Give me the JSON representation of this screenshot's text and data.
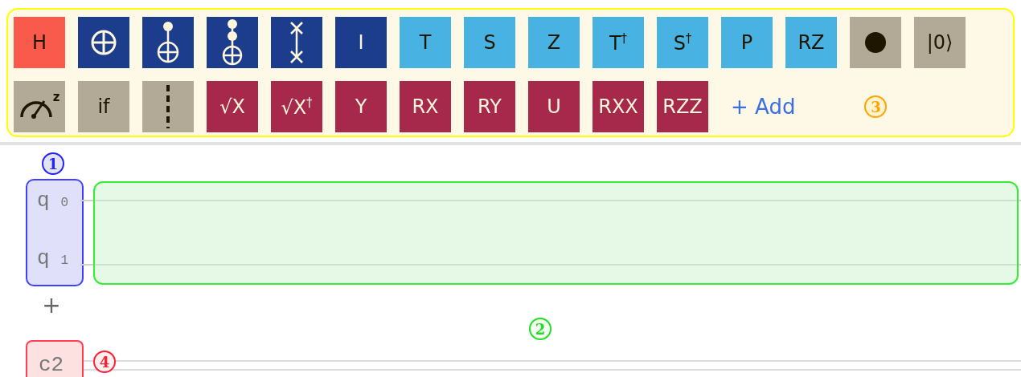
{
  "gate_palette": {
    "rows": [
      {
        "gates": [
          {
            "kind": "text",
            "label": "H",
            "color": "#fa5a4b"
          },
          {
            "kind": "not",
            "color": "#1b3d8b"
          },
          {
            "kind": "cnot",
            "color": "#1b3d8b"
          },
          {
            "kind": "toffoli",
            "color": "#1b3d8b"
          },
          {
            "kind": "swap",
            "color": "#1b3d8b"
          },
          {
            "kind": "text",
            "label": "I",
            "color": "#1b3d8b"
          },
          {
            "kind": "text",
            "label": "T",
            "color": "#48b2e3"
          },
          {
            "kind": "text",
            "label": "S",
            "color": "#48b2e3"
          },
          {
            "kind": "text",
            "label": "Z",
            "color": "#48b2e3"
          },
          {
            "kind": "text",
            "label": "T$^{†}$",
            "color": "#48b2e3"
          },
          {
            "kind": "text",
            "label": "S$^{†}$",
            "color": "#48b2e3"
          },
          {
            "kind": "text",
            "label": "P",
            "color": "#48b2e3"
          },
          {
            "kind": "text",
            "label": "RZ",
            "color": "#48b2e3"
          },
          {
            "kind": "control",
            "color": "#b2aa97"
          },
          {
            "kind": "text",
            "label": "|0⟩",
            "color": "#b2aa97"
          }
        ]
      },
      {
        "gates": [
          {
            "kind": "measure",
            "label": "z",
            "color": "#b2aa97"
          },
          {
            "kind": "text",
            "label": "if",
            "color": "#b2aa97"
          },
          {
            "kind": "barrier",
            "color": "#b2aa97"
          },
          {
            "kind": "text",
            "label": "√X",
            "color": "#a6284b"
          },
          {
            "kind": "text",
            "label": "√X$^{†}$",
            "color": "#a6284b"
          },
          {
            "kind": "text",
            "label": "Y",
            "color": "#a6284b"
          },
          {
            "kind": "text",
            "label": "RX",
            "color": "#a6284b"
          },
          {
            "kind": "text",
            "label": "RY",
            "color": "#a6284b"
          },
          {
            "kind": "text",
            "label": "U",
            "color": "#a6284b"
          },
          {
            "kind": "text",
            "label": "RXX",
            "color": "#a6284b"
          },
          {
            "kind": "text",
            "label": "RZZ",
            "color": "#a6284b"
          }
        ]
      }
    ],
    "add_label": "+ Add",
    "marker": {
      "text": "3",
      "color": "#ffa400"
    }
  },
  "circuit": {
    "marker": {
      "text": "1",
      "color": "#2323ff"
    },
    "qubits": [
      {
        "name": "q",
        "index": "0"
      },
      {
        "name": "q",
        "index": "1"
      }
    ],
    "add_qubit": "+",
    "drop_area_marker": {
      "text": "2",
      "color": "#22dd22"
    },
    "classical": {
      "name": "c2",
      "marker": {
        "text": "4",
        "color": "#ff1f35"
      }
    }
  }
}
